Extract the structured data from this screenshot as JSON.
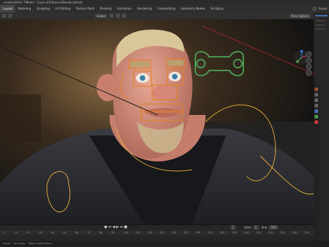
{
  "window": {
    "title": "...enetech\\Pack 7\\Model - Copie (43)\\Source\\Blender.blend]"
  },
  "workspaces": [
    "Layout",
    "Modeling",
    "Sculpting",
    "UV Editing",
    "Texture Paint",
    "Shading",
    "Animation",
    "Rendering",
    "Compositing",
    "Geometry Nodes",
    "Scripting"
  ],
  "active_workspace": "Layout",
  "header": {
    "mode_label": "Global",
    "pose_options": "Pose Options",
    "scene_label": "Scene"
  },
  "viewport": {
    "status_hint": ""
  },
  "timeline": {
    "start_label": "Start",
    "end_label": "End",
    "current_frame": "1",
    "start_frame": "1",
    "end_frame": "250",
    "ruler_ticks": [
      "0",
      "10",
      "20",
      "30",
      "40",
      "50",
      "60",
      "70",
      "80",
      "90",
      "100",
      "110",
      "120",
      "130",
      "140",
      "150",
      "160",
      "170",
      "180",
      "190",
      "200",
      "210",
      "220",
      "230",
      "240",
      "250"
    ]
  },
  "status_bar": {
    "item1": "Select",
    "item2": "Pan View",
    "item3": "Pose Context Menu"
  },
  "colors": {
    "accent": "#4772b3",
    "rig_orange": "#e0822c",
    "rig_green": "#4a9a52",
    "rig_red": "#d23a3a"
  }
}
